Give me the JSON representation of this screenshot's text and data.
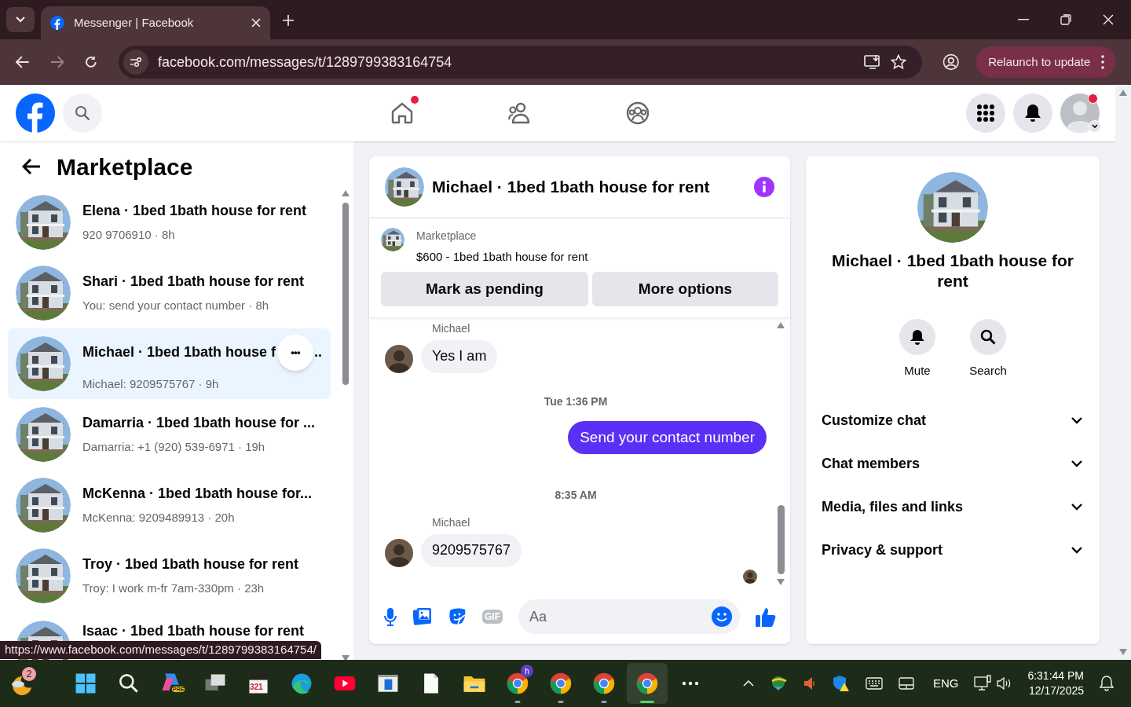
{
  "browser": {
    "tab_title": "Messenger | Facebook",
    "url": "facebook.com/messages/t/1289799383164754",
    "relaunch_button": "Relaunch to update"
  },
  "nav": {
    "icons": [
      {
        "kind": "home",
        "badge": true
      },
      {
        "kind": "friends",
        "badge": false
      },
      {
        "kind": "groups",
        "badge": false
      }
    ],
    "account_badge": true
  },
  "sidebar": {
    "title": "Marketplace",
    "conversations": [
      {
        "title": "Elena · 1bed 1bath house for rent",
        "subtitle": "920 9706910 · 8h",
        "selected": false
      },
      {
        "title": "Shari · 1bed 1bath house for rent",
        "subtitle": "You: send your contact number · 8h",
        "selected": false
      },
      {
        "title": "Michael · 1bed 1bath house f",
        "subtitle": "Michael: 9209575767 · 9h",
        "selected": true
      },
      {
        "title": "Damarria · 1bed 1bath house for ...",
        "subtitle": "Damarria: +1 (920) 539-6971 · 19h",
        "selected": false
      },
      {
        "title": "McKenna · 1bed 1bath house for...",
        "subtitle": "McKenna: 9209489913 · 20h",
        "selected": false
      },
      {
        "title": "Troy · 1bed 1bath house for rent",
        "subtitle": "Troy: I work m-fr 7am-330pm · 23h",
        "selected": false
      },
      {
        "title": "Isaac · 1bed 1bath house for rent",
        "selected": false
      }
    ],
    "row_menu_dots": "•••",
    "trailing_dots": ".."
  },
  "chat": {
    "title": "Michael · 1bed 1bath house for rent",
    "listing": {
      "label": "Marketplace",
      "text": "$600 - 1bed 1bath house for rent",
      "buttons": [
        "Mark as pending",
        "More options"
      ]
    },
    "messages": [
      {
        "kind": "incoming",
        "sender": "Michael",
        "text": "Yes I am"
      },
      {
        "kind": "timestamp",
        "text": "Tue 1:36 PM"
      },
      {
        "kind": "outgoing",
        "text": "Send your contact number"
      },
      {
        "kind": "timestamp",
        "text": "8:35 AM"
      },
      {
        "kind": "incoming",
        "sender": "Michael",
        "text": "9209575767"
      }
    ],
    "composer": {
      "placeholder": "Aa",
      "gif_label": "GIF"
    }
  },
  "details": {
    "name": "Michael · 1bed 1bath house for rent",
    "actions": [
      {
        "kind": "mute",
        "label": "Mute"
      },
      {
        "kind": "search",
        "label": "Search"
      }
    ],
    "sections": [
      {
        "label": "Customize chat",
        "expanded": false
      },
      {
        "label": "Chat members",
        "expanded": false
      },
      {
        "label": "Media, files and links",
        "expanded": false
      },
      {
        "label": "Privacy & support",
        "expanded": false
      }
    ]
  },
  "status_url": "https://www.facebook.com/messages/t/1289799383164754/",
  "taskbar": {
    "weather_badge": "2",
    "apps": [
      {
        "kind": "windows",
        "active": false,
        "running": false
      },
      {
        "kind": "search",
        "active": false,
        "running": false
      },
      {
        "kind": "copilot",
        "label": "PRE",
        "active": false,
        "running": false
      },
      {
        "kind": "taskview",
        "active": false,
        "running": false
      },
      {
        "kind": "media",
        "label": "321",
        "active": false,
        "running": false
      },
      {
        "kind": "edge",
        "active": false,
        "running": false
      },
      {
        "kind": "youtube",
        "active": false,
        "running": false
      },
      {
        "kind": "window",
        "active": false,
        "running": false
      },
      {
        "kind": "file",
        "active": false,
        "running": false
      },
      {
        "kind": "folder",
        "active": false,
        "running": false
      },
      {
        "kind": "chrome",
        "label": "h",
        "active": false,
        "running": true
      },
      {
        "kind": "chrome",
        "active": false,
        "running": true
      },
      {
        "kind": "chrome",
        "active": false,
        "running": true
      },
      {
        "kind": "chrome",
        "active": true,
        "running": true
      },
      {
        "kind": "more",
        "active": false,
        "running": false
      }
    ],
    "language": "ENG",
    "time": "6:31:44 PM",
    "date": "12/17/2025"
  }
}
